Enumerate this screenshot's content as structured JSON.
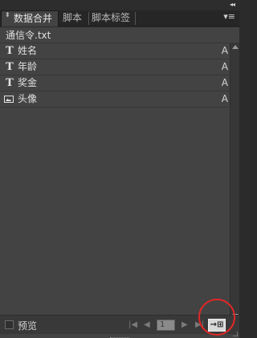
{
  "panel": {
    "collapse_glyph": "◂◂",
    "menu_glyph": "▾≡"
  },
  "tabs": [
    {
      "label": "数据合并",
      "active": true,
      "glyph": "⬍"
    },
    {
      "label": "脚本",
      "active": false
    },
    {
      "label": "脚本标签",
      "active": false
    }
  ],
  "source_file": "通信令.txt",
  "fields": [
    {
      "label": "姓名",
      "type": "text",
      "icon": "T",
      "suffix": "A"
    },
    {
      "label": "年龄",
      "type": "text",
      "icon": "T",
      "suffix": "A"
    },
    {
      "label": "奖金",
      "type": "text",
      "icon": "T",
      "suffix": "A"
    },
    {
      "label": "头像",
      "type": "image",
      "icon": "image-icon",
      "suffix": "A"
    }
  ],
  "footer": {
    "preview_label": "预览",
    "preview_checked": false,
    "first_glyph": "|◀",
    "prev_glyph": "◀",
    "page_value": "1",
    "next_glyph": "▶",
    "last_glyph": "▶|",
    "create_merged_glyph": "→⊞"
  },
  "colors": {
    "highlight": "#e02828",
    "panel_bg": "#434343"
  }
}
